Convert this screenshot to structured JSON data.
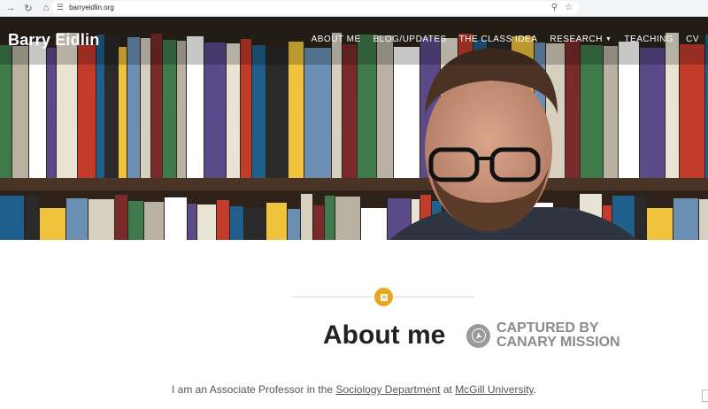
{
  "browser": {
    "url": "barryeidlin.org",
    "icons": [
      "back-arrow-icon",
      "reload-icon",
      "home-icon",
      "site-settings-icon",
      "zoom-icon",
      "bookmark-star-icon"
    ]
  },
  "site": {
    "title": "Barry Eidlin",
    "nav": [
      {
        "label": "ABOUT ME"
      },
      {
        "label": "BLOG/UPDATES"
      },
      {
        "label": "THE CLASS IDEA"
      },
      {
        "label": "RESEARCH",
        "has_dropdown": true
      },
      {
        "label": "TEACHING"
      },
      {
        "label": "CV"
      }
    ]
  },
  "about": {
    "heading": "About me",
    "stamp_line1": "CAPTURED BY",
    "stamp_line2": "CANARY MISSION",
    "intro_before": "I am an Associate Professor in the ",
    "intro_link1": "Sociology Department",
    "intro_middle": " at ",
    "intro_link2": "McGill University",
    "intro_after": "."
  },
  "colors": {
    "accent": "#e5a823",
    "stamp_gray": "#8a8a8a",
    "text": "#555555"
  }
}
